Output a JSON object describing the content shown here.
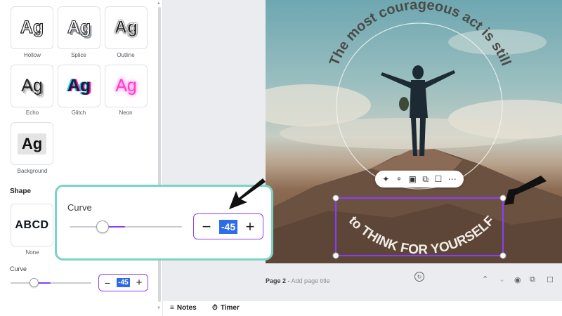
{
  "colors": {
    "accent": "#8b3dff",
    "selection_blue": "#2e6be6",
    "callout_border": "#7ad3c4"
  },
  "effects_panel": {
    "styles": [
      {
        "glyph": "Ag",
        "label": "Hollow"
      },
      {
        "glyph": "Ag",
        "label": "Splice"
      },
      {
        "glyph": "Ag",
        "label": "Outline"
      },
      {
        "glyph": "Ag",
        "label": "Echo"
      },
      {
        "glyph": "Ag",
        "label": "Glitch"
      },
      {
        "glyph": "Ag",
        "label": "Neon"
      },
      {
        "glyph": "Ag",
        "label": "Background"
      }
    ],
    "shape_heading": "Shape",
    "shape_option": {
      "glyph": "ABCD",
      "label": "None"
    },
    "curve": {
      "label": "Curve",
      "value": "-45",
      "slider_fraction": 0.25
    }
  },
  "callout": {
    "label": "Curve",
    "value": "-45",
    "slider_fraction": 0.25
  },
  "canvas": {
    "arc_text_top": "The most courageous act is still",
    "arc_text_bottom": "to THINK FOR YOURSELF",
    "toolbar_icons": [
      "magic-icon",
      "comment-icon",
      "lock-icon",
      "duplicate-icon",
      "trash-icon",
      "more-icon"
    ]
  },
  "page2": {
    "label": "Page 2",
    "separator": " - ",
    "title_placeholder": "Add page title"
  },
  "bottom_bar": {
    "notes_label": "Notes",
    "timer_label": "Timer"
  }
}
